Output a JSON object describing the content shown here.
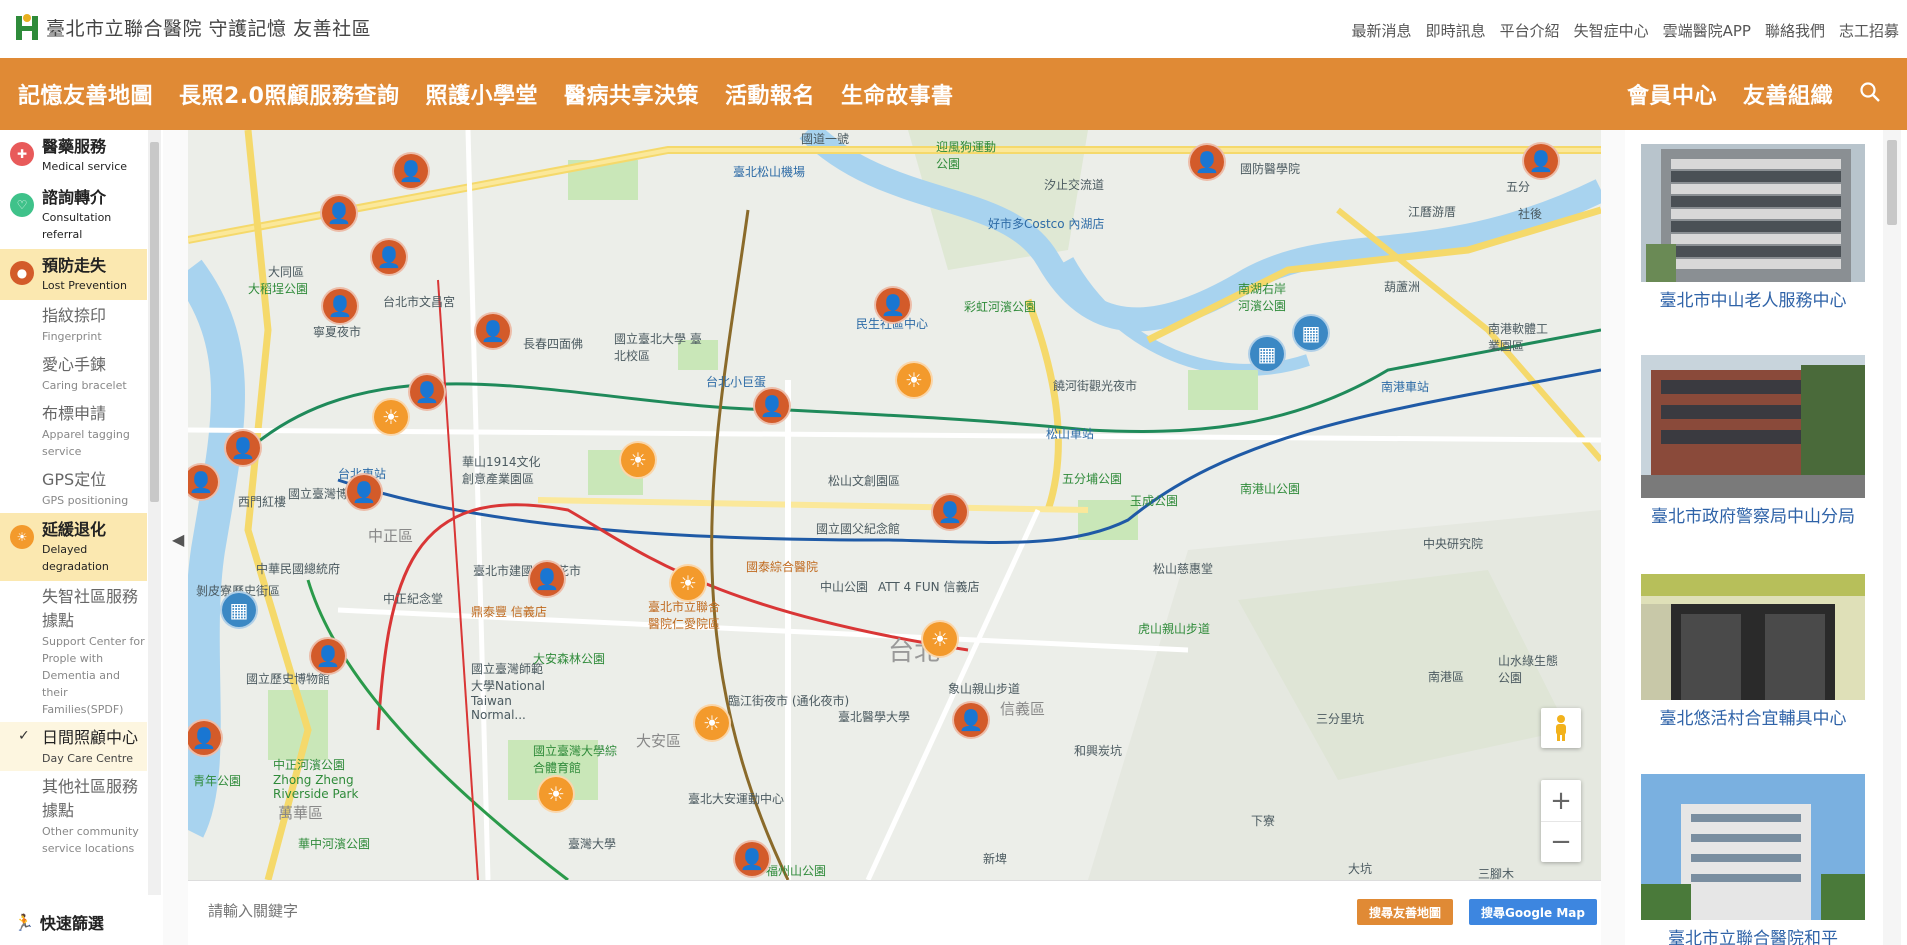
{
  "header": {
    "logo_letter": "H",
    "title": "臺北市立聯合醫院 守護記憶 友善社區",
    "links": [
      "最新消息",
      "即時訊息",
      "平台介紹",
      "失智症中心",
      "雲端醫院APP",
      "聯絡我們",
      "志工招募"
    ]
  },
  "nav": {
    "left": [
      "記憶友善地圖",
      "長照2.0照顧服務查詢",
      "照護小學堂",
      "醫病共享決策",
      "活動報名",
      "生命故事書"
    ],
    "right": [
      "會員中心",
      "友善組織"
    ]
  },
  "sidebar": {
    "categories": [
      {
        "zh": "醫藥服務",
        "en": "Medical service",
        "color": "#e85a5a",
        "active": false,
        "subs": []
      },
      {
        "zh": "諮詢轉介",
        "en": "Consultation referral",
        "color": "#3fc28a",
        "active": false,
        "subs": []
      },
      {
        "zh": "預防走失",
        "en": "Lost Prevention",
        "color": "#d35b2a",
        "active": true,
        "subs": [
          {
            "zh": "指紋捺印",
            "en": "Fingerprint"
          },
          {
            "zh": "愛心手鍊",
            "en": "Caring bracelet"
          },
          {
            "zh": "布標申請",
            "en": "Apparel tagging service"
          },
          {
            "zh": "GPS定位",
            "en": "GPS positioning"
          }
        ]
      },
      {
        "zh": "延緩退化",
        "en": "Delayed degradation",
        "color": "#f39a2c",
        "active": true,
        "subs": [
          {
            "zh": "失智社區服務據點",
            "en": "Support Center for Prople with Dementia and their Families(SPDF)",
            "checked": false
          },
          {
            "zh": "日間照顧中心",
            "en": "Day Care Centre",
            "checked": true
          },
          {
            "zh": "其他社區服務據點",
            "en": "Other community service locations",
            "checked": false
          }
        ]
      }
    ],
    "quick_filter": "快速篩選"
  },
  "map": {
    "labels": [
      "國道一號",
      "臺北松山機場",
      "迎風狗運動公園",
      "國防醫學院",
      "五分",
      "社後",
      "江曆游厝",
      "汐止交流道",
      "葫蘆洲",
      "南港軟體工業園區",
      "好市多Costco 內湖店",
      "大同區",
      "大稻埕公園",
      "台北市文昌宮",
      "寧夏夜市",
      "長春四面佛",
      "國立臺北大學 臺北校區",
      "民生社區中心",
      "彩虹河濱公園",
      "南湖右岸河濱公園",
      "台北車站",
      "國立臺灣博物館",
      "台北小巨蛋",
      "饒河街觀光夜市",
      "松山車站",
      "南港車站",
      "華山1914文化創意產業園區",
      "松山文創園區",
      "五分埔公園",
      "玉成公園",
      "南港山公園",
      "中正區",
      "國立國父紀念館",
      "中央研究院",
      "臺北市建國假日花市",
      "國泰綜合醫院",
      "中山公園",
      "ATT 4 FUN 信義店",
      "松山慈惠堂",
      "中華民國總統府",
      "剝皮寮歷史街區",
      "中正紀念堂",
      "鼎泰豐 信義店",
      "臺北市立聯合醫院仁愛院區",
      "台北",
      "虎山親山步道",
      "國立歷史博物館",
      "國立臺灣師範大學National Taiwan Normal...",
      "大安森林公園",
      "臨江街夜市 (通化夜市)",
      "象山親山步道",
      "信義區",
      "南港區",
      "山水綠生態公園",
      "中正河濱公園 Zhong Zheng Riverside Park",
      "國立臺灣大學綜合體育館",
      "大安區",
      "臺北醫學大學",
      "和興炭坑",
      "三分里坑",
      "臺北大安運動中心",
      "臺灣大學",
      "福州山公園",
      "下寮",
      "新埤",
      "大坑",
      "三腳木",
      "青年公園",
      "萬華區",
      "西門紅樓",
      "華中河濱公園"
    ]
  },
  "search": {
    "placeholder": "請輸入關鍵字",
    "btn_friendly": "搜尋友善地圖",
    "btn_google": "搜尋Google Map"
  },
  "cards": [
    {
      "title": "臺北市中山老人服務中心"
    },
    {
      "title": "臺北市政府警察局中山分局"
    },
    {
      "title": "臺北悠活村合宜輔具中心"
    },
    {
      "title": "臺北市立聯合醫院和平"
    }
  ],
  "colors": {
    "brand": "#e08a35",
    "link": "#2f63a8",
    "person_pin": "#d35b2a",
    "sun_pin": "#f39a2c",
    "building_pin": "#3b88c4"
  }
}
